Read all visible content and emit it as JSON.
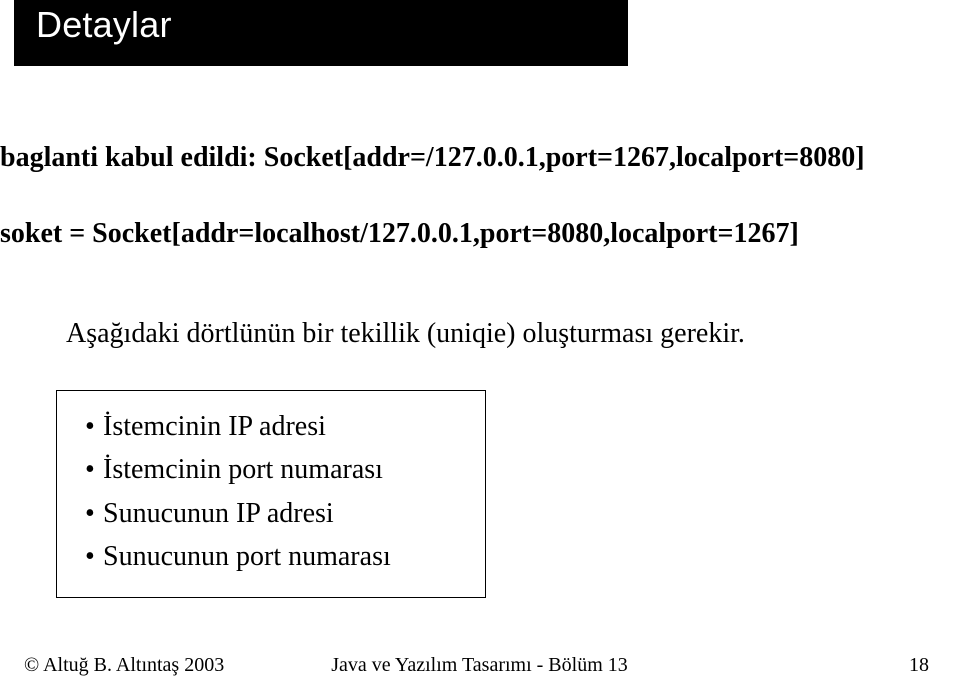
{
  "header": {
    "title": "Detaylar"
  },
  "main": {
    "line1": "baglanti kabul edildi: Socket[addr=/127.0.0.1,port=1267,localport=8080]",
    "line2": "soket = Socket[addr=localhost/127.0.0.1,port=8080,localport=1267]",
    "subhead": "Aşağıdaki dörtlünün bir tekillik (uniqie) oluşturması gerekir.",
    "box_items": [
      "İstemcinin IP adresi",
      "İstemcinin port numarası",
      "Sunucunun IP adresi",
      "Sunucunun port numarası"
    ]
  },
  "footer": {
    "left": "© Altuğ B. Altıntaş 2003",
    "center": "Java ve Yazılım Tasarımı  - Bölüm 13",
    "right": "18"
  }
}
